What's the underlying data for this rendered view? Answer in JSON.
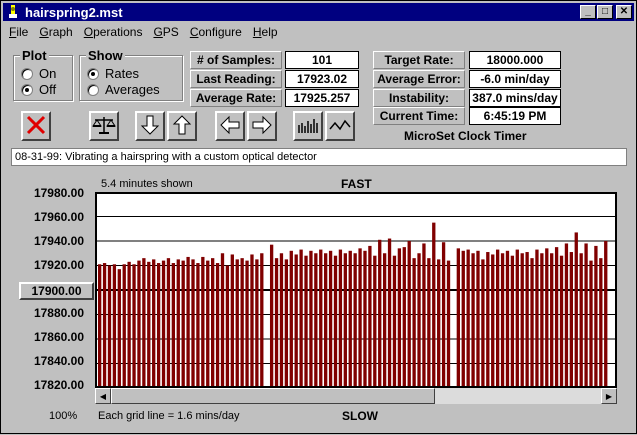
{
  "window": {
    "title": "hairspring2.mst"
  },
  "menu": [
    "File",
    "Graph",
    "Operations",
    "GPS",
    "Configure",
    "Help"
  ],
  "plot_group": {
    "title": "Plot",
    "options": [
      "On",
      "Off"
    ],
    "selected": "Off"
  },
  "show_group": {
    "title": "Show",
    "options": [
      "Rates",
      "Averages"
    ],
    "selected": "Rates"
  },
  "stats": {
    "samples_label": "# of Samples:",
    "samples_value": "101",
    "last_label": "Last Reading:",
    "last_value": "17923.02",
    "avg_label": "Average Rate:",
    "avg_value": "17925.257",
    "target_label": "Target Rate:",
    "target_value": "18000.000",
    "avgerr_label": "Average Error:",
    "avgerr_value": "-6.0 min/day",
    "instab_label": "Instability:",
    "instab_value": "387.0 mins/day",
    "time_label": "Current Time:",
    "time_value": "6:45:19 PM"
  },
  "product_label": "MicroSet Clock Timer",
  "toolbar_icons": [
    "clear-x-icon",
    "balance-scale-icon",
    "arrow-down-icon",
    "arrow-up-icon",
    "arrow-left-icon",
    "arrow-right-icon",
    "bar-graph-icon",
    "line-graph-icon"
  ],
  "status_text": "08-31-99: Vibrating a hairspring with a custom optical detector",
  "graph": {
    "minutes_shown": "5.4 minutes shown",
    "fast_label": "FAST",
    "slow_label": "SLOW",
    "zoom": "100%",
    "grid_note": "Each grid line = 1.6 mins/day",
    "center_button": "17900.00",
    "colors": {
      "bar": "#800000",
      "plot_bg": "#ffffff",
      "grid": "#000000"
    }
  },
  "chart_data": {
    "type": "bar",
    "ytick_labels": [
      "17980.00",
      "17960.00",
      "17940.00",
      "17920.00",
      "17900.00",
      "17880.00",
      "17860.00",
      "17840.00",
      "17820.00"
    ],
    "ylim": [
      17820,
      17980
    ],
    "gaps_after_index": [
      33,
      70
    ],
    "values": [
      17921,
      17922,
      17920,
      17921,
      17917,
      17921,
      17923,
      17921,
      17924,
      17926,
      17923,
      17925,
      17922,
      17924,
      17926,
      17922,
      17925,
      17924,
      17927,
      17925,
      17922,
      17927,
      17924,
      17926,
      17922,
      17930,
      17920,
      17929,
      17925,
      17926,
      17924,
      17929,
      17925,
      17930,
      17937,
      17926,
      17930,
      17925,
      17932,
      17929,
      17933,
      17928,
      17932,
      17930,
      17933,
      17930,
      17932,
      17928,
      17933,
      17930,
      17932,
      17930,
      17934,
      17932,
      17936,
      17928,
      17941,
      17930,
      17942,
      17928,
      17934,
      17935,
      17940,
      17926,
      17930,
      17938,
      17926,
      17955,
      17925,
      17939,
      17924,
      17934,
      17932,
      17933,
      17930,
      17932,
      17925,
      17931,
      17929,
      17933,
      17930,
      17932,
      17928,
      17933,
      17930,
      17931,
      17926,
      17933,
      17930,
      17934,
      17930,
      17935,
      17928,
      17938,
      17931,
      17947,
      17930,
      17938,
      17924,
      17936,
      17926,
      17940
    ]
  }
}
